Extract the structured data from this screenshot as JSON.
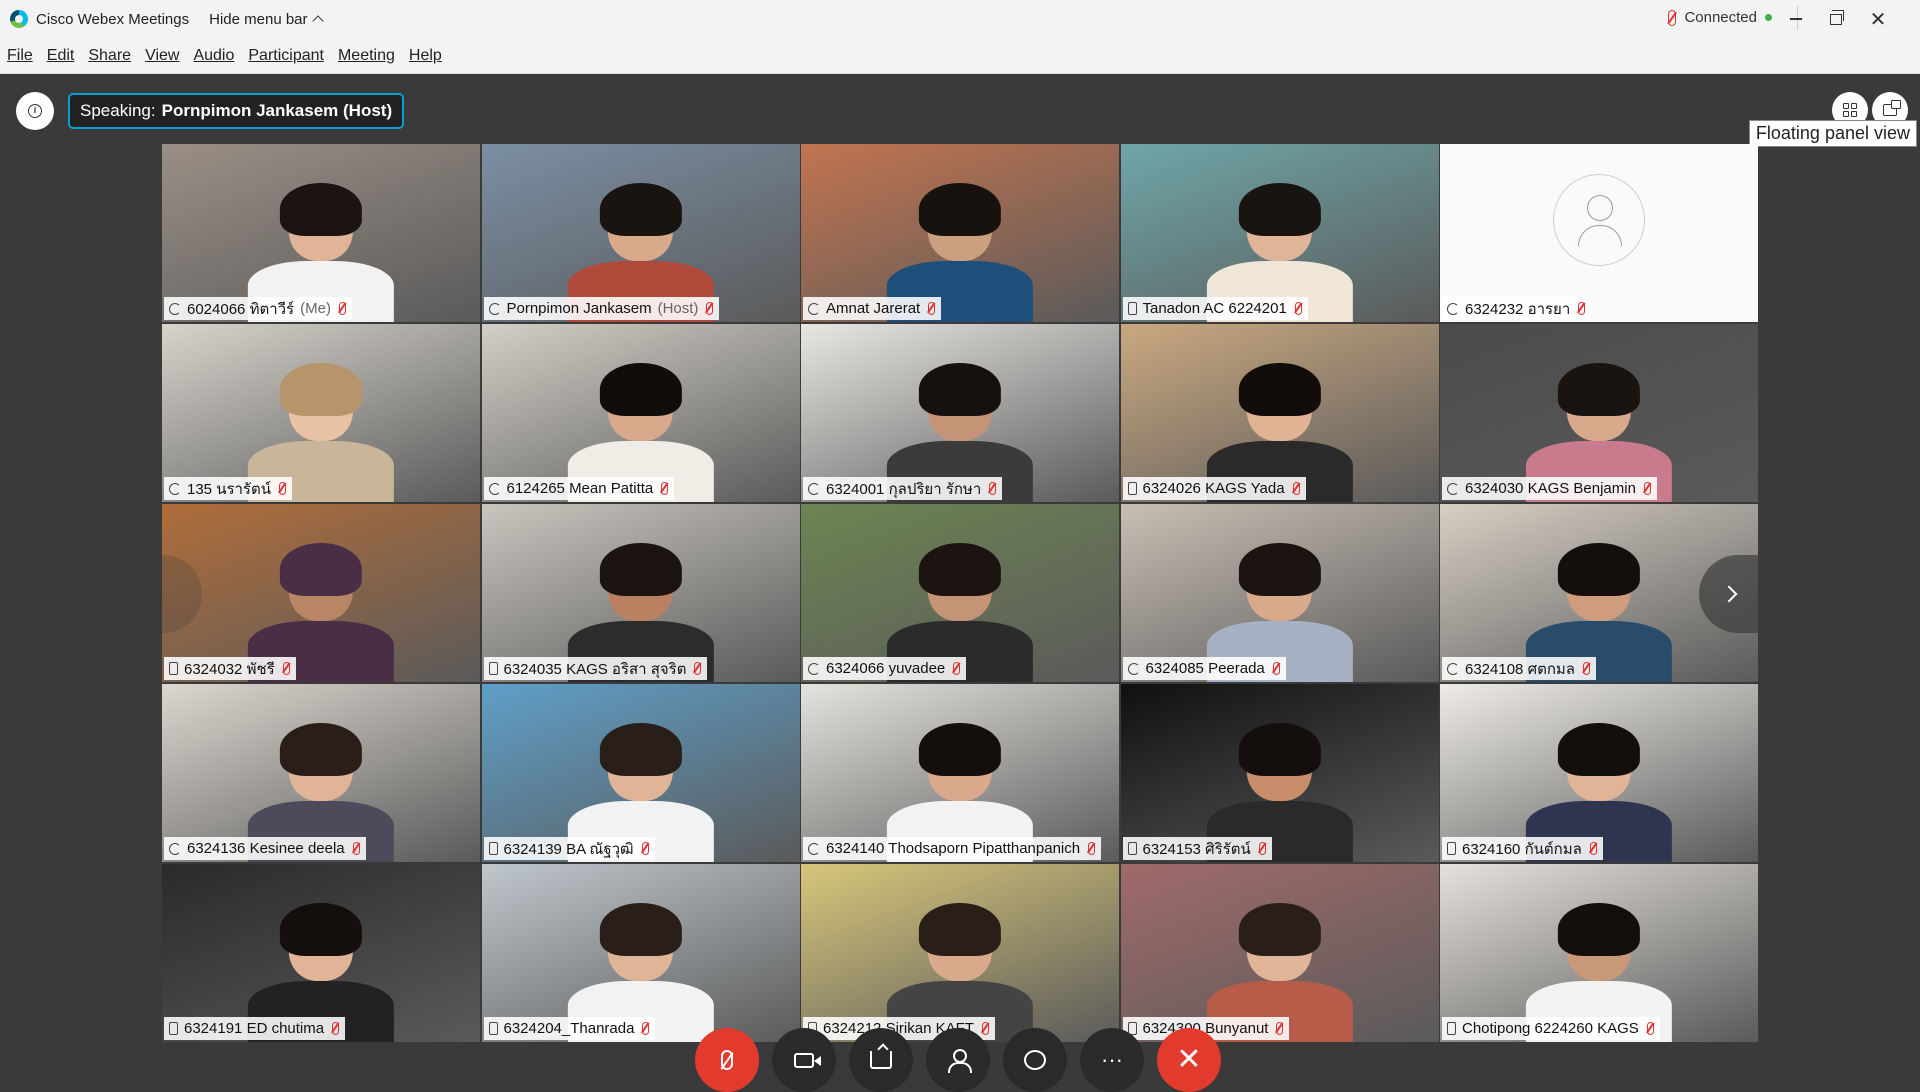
{
  "window": {
    "app_title": "Cisco Webex Meetings",
    "hide_menu_label": "Hide menu bar",
    "status": "Connected"
  },
  "menu": [
    "File",
    "Edit",
    "Share",
    "View",
    "Audio",
    "Participant",
    "Meeting",
    "Help"
  ],
  "speaking": {
    "prefix": "Speaking:",
    "name": "Pornpimon Jankasem (Host)"
  },
  "tooltip": "Floating panel view",
  "participants": [
    {
      "name": "6024066 ทิตาวีร์",
      "tag": "(Me)",
      "icon": "sync-icon",
      "bg": "#9a8f86",
      "shirt": "#f2f2f2",
      "hair": "#1c1410",
      "skin": "#e2b497"
    },
    {
      "name": "Pornpimon Jankasem",
      "tag": "(Host)",
      "icon": "sync-icon",
      "bg": "#7b8fa3",
      "shirt": "#b24a3c",
      "hair": "#1a1410",
      "skin": "#d9a98b",
      "active": true
    },
    {
      "name": "Amnat Jarerat",
      "icon": "sync-icon",
      "bg": "#c2744f",
      "shirt": "#1d4f7a",
      "hair": "#18120e",
      "skin": "#caa07e"
    },
    {
      "name": "Tanadon AC 6224201",
      "icon": "phone-icon",
      "bg": "#6fa6a8",
      "shirt": "#efe6d8",
      "hair": "#1a1410",
      "skin": "#e0b496"
    },
    {
      "name": "6324232 อารยา",
      "icon": "sync-icon",
      "avatar": true
    },
    {
      "name": "135 นรารัตน์",
      "icon": "sync-icon",
      "bg": "#d8d4cc",
      "shirt": "#c9b59a",
      "hair": "#b8946a",
      "skin": "#e8c2a4"
    },
    {
      "name": "6124265 Mean Patitta",
      "icon": "sync-icon",
      "bg": "#d3cfc6",
      "shirt": "#f0ece6",
      "hair": "#120d0b",
      "skin": "#d8a98a"
    },
    {
      "name": "6324001 กุลปริยา รักษา",
      "icon": "sync-icon",
      "bg": "#e9e7e3",
      "shirt": "#3b3b3b",
      "hair": "#17110d",
      "skin": "#c59476"
    },
    {
      "name": "6324026 KAGS Yada",
      "icon": "phone-icon",
      "bg": "#c9a880",
      "shirt": "#2a2a2a",
      "hair": "#120d0b",
      "skin": "#e0b394"
    },
    {
      "name": "6324030 KAGS Benjamin",
      "icon": "sync-icon",
      "bg": "#4b4b4b",
      "shirt": "#c77b8c",
      "hair": "#1a1410",
      "skin": "#d9a98b"
    },
    {
      "name": "6324032 พัชรี",
      "icon": "phone-icon",
      "bg": "#b06d3a",
      "shirt": "#4a2e45",
      "hair": "#4a2e45",
      "skin": "#b88566"
    },
    {
      "name": "6324035 KAGS อริสา สุจริต",
      "icon": "phone-icon",
      "bg": "#c9c5be",
      "shirt": "#2c2c2c",
      "hair": "#1b1410",
      "skin": "#b98161"
    },
    {
      "name": "6324066 yuvadee",
      "icon": "sync-icon",
      "bg": "#6d8452",
      "shirt": "#2b2b2b",
      "hair": "#1b1410",
      "skin": "#c59476"
    },
    {
      "name": "6324085 Peerada",
      "icon": "sync-icon",
      "bg": "#c8bfb4",
      "shirt": "#a7b1c4",
      "hair": "#1b1410",
      "skin": "#d9a98b"
    },
    {
      "name": "6324108 ศตกมล",
      "icon": "sync-icon",
      "bg": "#d6cfc4",
      "shirt": "#2a4c6b",
      "hair": "#140f0c",
      "skin": "#cf9c7d"
    },
    {
      "name": "6324136 Kesinee deela",
      "icon": "sync-icon",
      "bg": "#dcd7cf",
      "shirt": "#4d4a5c",
      "hair": "#2a1f18",
      "skin": "#e2b497"
    },
    {
      "name": "6324139 BA ณัฐวุฒิ",
      "icon": "phone-icon",
      "bg": "#5f9fc8",
      "shirt": "#f2f2f2",
      "hair": "#2a1f18",
      "skin": "#e0b496"
    },
    {
      "name": "6324140 Thodsaporn Pipatthanpanich",
      "icon": "sync-icon",
      "bg": "#e5e3de",
      "shirt": "#f2f2f2",
      "hair": "#140f0c",
      "skin": "#d9a98b"
    },
    {
      "name": "6324153 ศิริรัตน์",
      "icon": "phone-icon",
      "bg": "#101010",
      "shirt": "#2a2a2a",
      "hair": "#140f0c",
      "skin": "#c88e6c"
    },
    {
      "name": "6324160 กันต์กมล",
      "icon": "phone-icon",
      "bg": "#efece7",
      "shirt": "#2f3550",
      "hair": "#140f0c",
      "skin": "#e0b496"
    },
    {
      "name": "6324191 ED chutima",
      "icon": "phone-icon",
      "bg": "#2a2a2a",
      "shirt": "#222",
      "hair": "#140f0c",
      "skin": "#e2b497"
    },
    {
      "name": "6324204_Thanrada",
      "icon": "phone-icon",
      "bg": "#bfc7cc",
      "shirt": "#f2f2f2",
      "hair": "#2a1f18",
      "skin": "#e0b496"
    },
    {
      "name": "6324212 Sirikan KAFT",
      "icon": "phone-icon",
      "bg": "#d7c67a",
      "shirt": "#444",
      "hair": "#2a1f18",
      "skin": "#d9a98b"
    },
    {
      "name": "6324300 Bunyanut",
      "icon": "phone-icon",
      "bg": "#a06a6a",
      "shirt": "#b85c4a",
      "hair": "#2a1f18",
      "skin": "#e0b496"
    },
    {
      "name": "Chotipong 6224260 KAGS",
      "icon": "phone-icon",
      "bg": "#e5e1db",
      "shirt": "#f2f2f2",
      "hair": "#140f0c",
      "skin": "#c89878"
    }
  ],
  "controls": [
    {
      "name": "mute-button",
      "style": "red",
      "icon": "mic"
    },
    {
      "name": "video-button",
      "style": "dark",
      "icon": "cam"
    },
    {
      "name": "share-button",
      "style": "dark",
      "icon": "share"
    },
    {
      "name": "participants-button",
      "style": "dark",
      "icon": "person"
    },
    {
      "name": "chat-button",
      "style": "dark",
      "icon": "chat"
    },
    {
      "name": "more-button",
      "style": "dark",
      "icon": "more",
      "label": "···"
    },
    {
      "name": "end-meeting-button",
      "style": "end",
      "icon": "x",
      "label": "✕"
    }
  ]
}
